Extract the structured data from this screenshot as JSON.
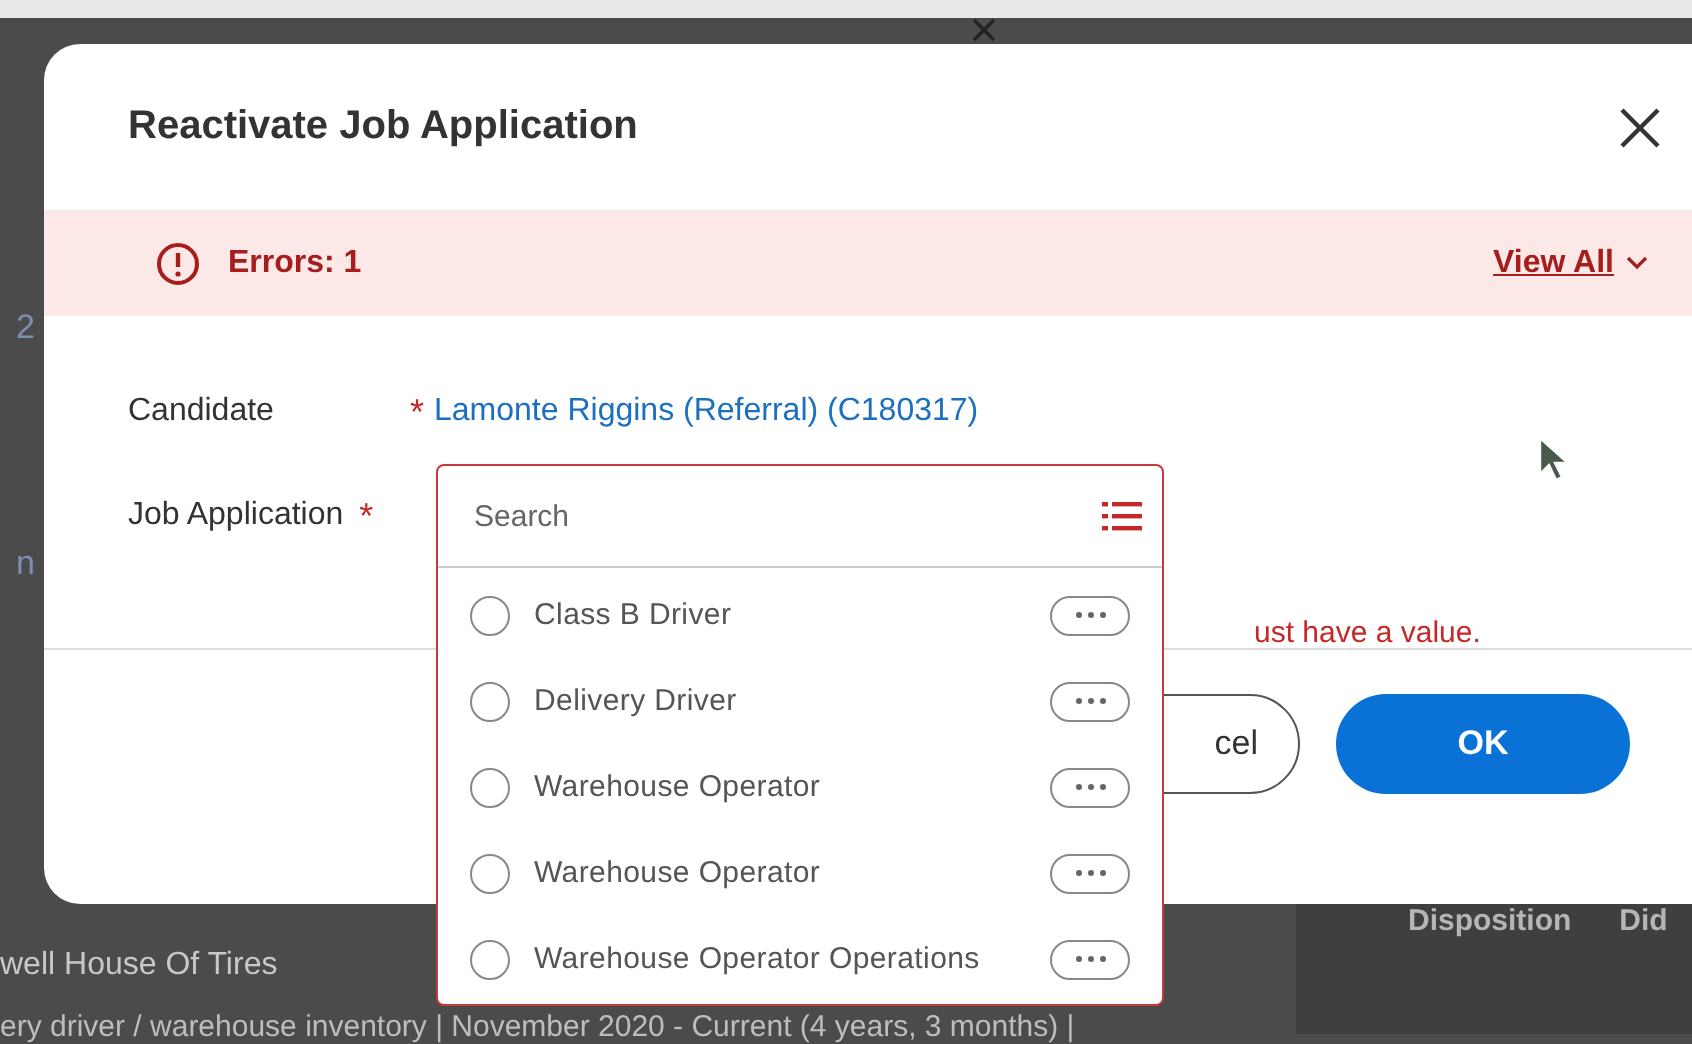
{
  "backdrop": {
    "fragments": [
      "2",
      "n"
    ],
    "company": "well House Of Tires",
    "job_line": "ery driver / warehouse inventory | November 2020 - Current (4 years, 3 months) |",
    "side_card": {
      "label": "Disposition",
      "value": "Did"
    }
  },
  "dialog": {
    "title": "Reactivate Job Application",
    "error_banner": {
      "count": "Errors: 1",
      "link": "View All"
    },
    "fields": [
      {
        "label": "Candidate",
        "required": true,
        "required_mark": "*",
        "value": "Lamonte Riggins (Referral) (C180317)"
      },
      {
        "label": "Job Application",
        "required": true,
        "required_mark": "*"
      }
    ],
    "error_message": "ust have a value.",
    "buttons": {
      "cancel": "cel",
      "ok": "OK"
    },
    "dropdown": {
      "placeholder": "Search",
      "options": [
        {
          "label": "Class B Driver",
          "selected": false
        },
        {
          "label": "Delivery Driver",
          "selected": false
        },
        {
          "label": "Warehouse Operator",
          "selected": false
        },
        {
          "label": "Warehouse Operator",
          "selected": false
        },
        {
          "label": "Warehouse Operator Operations",
          "selected": false
        }
      ]
    }
  }
}
